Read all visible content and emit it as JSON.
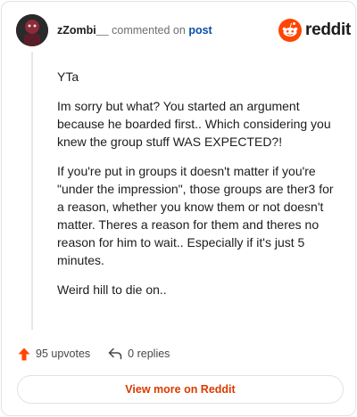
{
  "header": {
    "username": "zZombi__",
    "commented_on": "commented on",
    "post_link": "post",
    "brand": "reddit"
  },
  "comment": {
    "paragraphs": [
      "YTa",
      "Im sorry but what? You started an argument because he boarded first.. Which considering you knew the group stuff WAS EXPECTED?!",
      "If you're put in groups it doesn't matter if you're \"under the impression\", those groups are ther3 for a reason, whether you know them or not doesn't matter. Theres a reason for them and theres no reason for him to wait.. Especially if it's just 5 minutes.",
      "Weird hill to die on.."
    ]
  },
  "actions": {
    "upvotes": "95 upvotes",
    "replies": "0 replies"
  },
  "footer": {
    "view_more": "View more on Reddit"
  },
  "colors": {
    "reddit_orange": "#ff4500",
    "link_blue": "#0a4fa8",
    "view_more_text": "#d93a00"
  },
  "icons": {
    "avatar": "avatar",
    "brand": "reddit-snoo-icon",
    "upvote": "upvote-arrow-icon",
    "reply": "reply-arrow-icon"
  }
}
